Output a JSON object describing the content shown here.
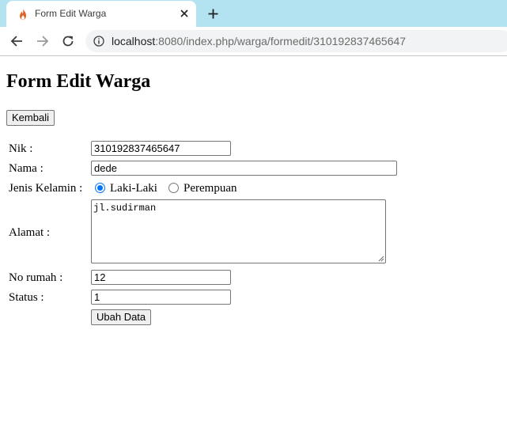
{
  "browser": {
    "tab_title": "Form Edit Warga",
    "url_host": "localhost",
    "url_rest": ":8080/index.php/warga/formedit/310192837465647"
  },
  "page": {
    "title": "Form Edit Warga",
    "back_button": "Kembali",
    "submit_button": "Ubah Data"
  },
  "form": {
    "nik": {
      "label": "Nik :",
      "value": "310192837465647"
    },
    "nama": {
      "label": "Nama :",
      "value": "dede"
    },
    "jenis_kelamin": {
      "label": "Jenis Kelamin :",
      "options": [
        "Laki-Laki",
        "Perempuan"
      ],
      "selected": "Laki-Laki"
    },
    "alamat": {
      "label": "Alamat :",
      "value": "jl.sudirman"
    },
    "no_rumah": {
      "label": "No rumah :",
      "value": "12"
    },
    "status": {
      "label": "Status :",
      "value": "1"
    }
  },
  "colors": {
    "tabbar": "#b3e3f1",
    "accent": "#0075ff"
  },
  "icons": [
    "favicon-flame-icon",
    "close-icon",
    "plus-icon",
    "back-arrow-icon",
    "forward-arrow-icon",
    "reload-icon",
    "info-icon"
  ]
}
